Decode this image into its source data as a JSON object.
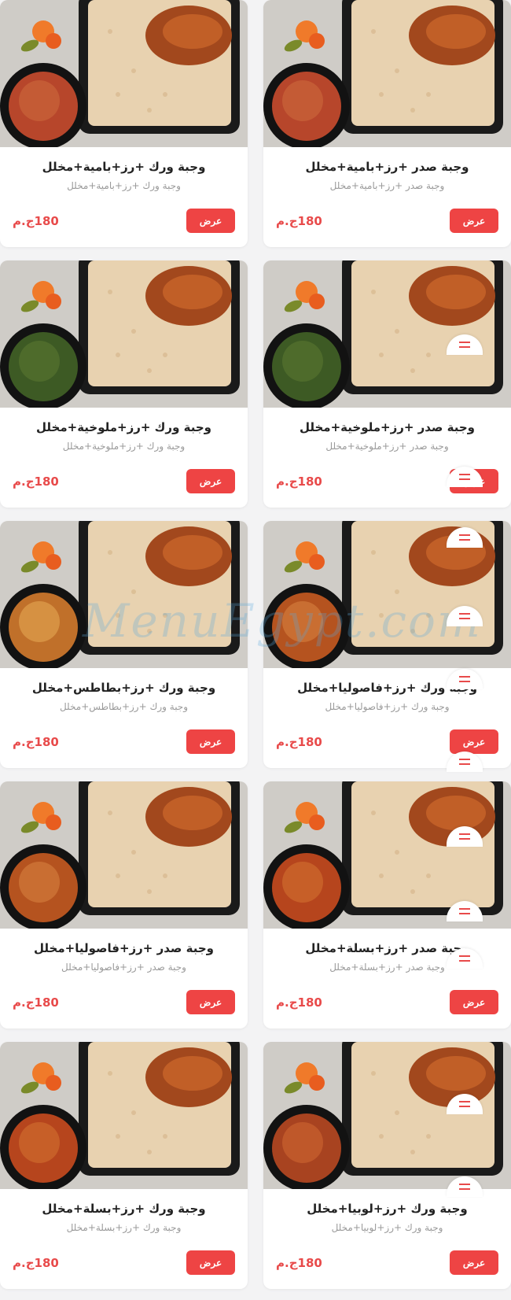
{
  "watermark": "MenuEgypt.com",
  "colors": {
    "accent": "#ee4444",
    "price": "#e84a4a",
    "background": "#f3f3f4"
  },
  "items": [
    {
      "title": "وجبة صدر +رز+بامية+مخلل",
      "desc": "وجبة صدر +رز+بامية+مخلل",
      "price": "180ج.م",
      "button": "عرض",
      "side": "bamia"
    },
    {
      "title": "وجبة ورك +رز+بامية+مخلل",
      "desc": "وجبة ورك +رز+بامية+مخلل",
      "price": "180ج.م",
      "button": "عرض",
      "side": "bamia"
    },
    {
      "title": "وجبة صدر +رز+ملوخية+مخلل",
      "desc": "وجبة صدر +رز+ملوخية+مخلل",
      "price": "180ج.م",
      "button": "عرض",
      "side": "molokhia"
    },
    {
      "title": "وجبة ورك +رز+ملوخية+مخلل",
      "desc": "وجبة ورك +رز+ملوخية+مخلل",
      "price": "180ج.م",
      "button": "عرض",
      "side": "molokhia"
    },
    {
      "title": "وجبة ورك +رز+فاصوليا+مخلل",
      "desc": "وجبة ورك +رز+فاصوليا+مخلل",
      "price": "180ج.م",
      "button": "عرض",
      "side": "fasolia"
    },
    {
      "title": "وجبة ورك +رز+بطاطس+مخلل",
      "desc": "وجبة ورك +رز+بطاطس+مخلل",
      "price": "180ج.م",
      "button": "عرض",
      "side": "potato"
    },
    {
      "title": "وجبة صدر +رز+بسلة+مخلل",
      "desc": "وجبة صدر +رز+بسلة+مخلل",
      "price": "180ج.م",
      "button": "عرض",
      "side": "peas"
    },
    {
      "title": "وجبة صدر +رز+فاصوليا+مخلل",
      "desc": "وجبة صدر +رز+فاصوليا+مخلل",
      "price": "180ج.م",
      "button": "عرض",
      "side": "fasolia"
    },
    {
      "title": "وجبة ورك +رز+لوبيا+مخلل",
      "desc": "وجبة ورك +رز+لوبيا+مخلل",
      "price": "180ج.م",
      "button": "عرض",
      "side": "lobia"
    },
    {
      "title": "وجبة ورك +رز+بسلة+مخلل",
      "desc": "وجبة ورك +رز+بسلة+مخلل",
      "price": "180ج.م",
      "button": "عرض",
      "side": "peas"
    }
  ]
}
